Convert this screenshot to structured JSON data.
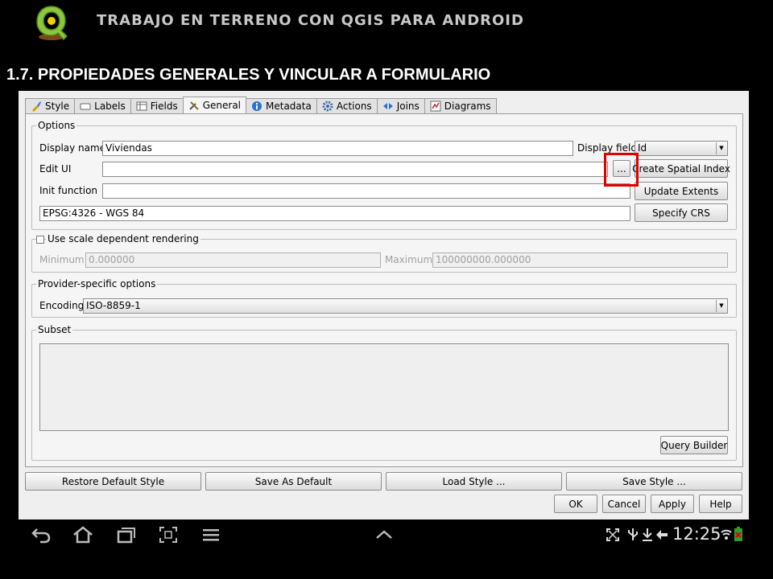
{
  "slide": {
    "header": "TRABAJO EN TERRENO CON QGIS PARA ANDROID",
    "section_title": "1.7. PROPIEDADES GENERALES Y VINCULAR A FORMULARIO"
  },
  "tabs": [
    {
      "label": "Style",
      "icon": "brush-icon"
    },
    {
      "label": "Labels",
      "icon": "label-icon"
    },
    {
      "label": "Fields",
      "icon": "table-icon"
    },
    {
      "label": "General",
      "icon": "tools-icon"
    },
    {
      "label": "Metadata",
      "icon": "info-icon"
    },
    {
      "label": "Actions",
      "icon": "gear-icon"
    },
    {
      "label": "Joins",
      "icon": "join-icon"
    },
    {
      "label": "Diagrams",
      "icon": "diagram-icon"
    }
  ],
  "active_tab": "General",
  "options": {
    "title": "Options",
    "display_name_label": "Display name",
    "display_name_value": "Viviendas",
    "display_field_label": "Display field",
    "display_field_value": "Id",
    "edit_ui_label": "Edit UI",
    "edit_ui_value": "",
    "browse_label": "...",
    "create_spatial_index": "Create Spatial Index",
    "init_function_label": "Init function",
    "init_function_value": "",
    "update_extents": "Update Extents",
    "crs_value": "EPSG:4326 - WGS 84",
    "specify_crs": "Specify CRS"
  },
  "scale": {
    "title": "Use scale dependent rendering",
    "checked": false,
    "minimum_label": "Minimum",
    "minimum_value": "0.000000",
    "maximum_label": "Maximum",
    "maximum_value": "100000000.000000"
  },
  "provider": {
    "title": "Provider-specific options",
    "encoding_label": "Encoding",
    "encoding_value": "ISO-8859-1"
  },
  "subset": {
    "title": "Subset",
    "query_builder": "Query Builder"
  },
  "style_buttons": {
    "restore_default": "Restore Default Style",
    "save_as_default": "Save As Default",
    "load_style": "Load Style ...",
    "save_style": "Save Style ..."
  },
  "dialog_buttons": {
    "ok": "OK",
    "cancel": "Cancel",
    "apply": "Apply",
    "help": "Help"
  },
  "statusbar": {
    "time": "12:25"
  },
  "colors": {
    "highlight": "#e00000",
    "header_text": "#c8c8c8"
  }
}
